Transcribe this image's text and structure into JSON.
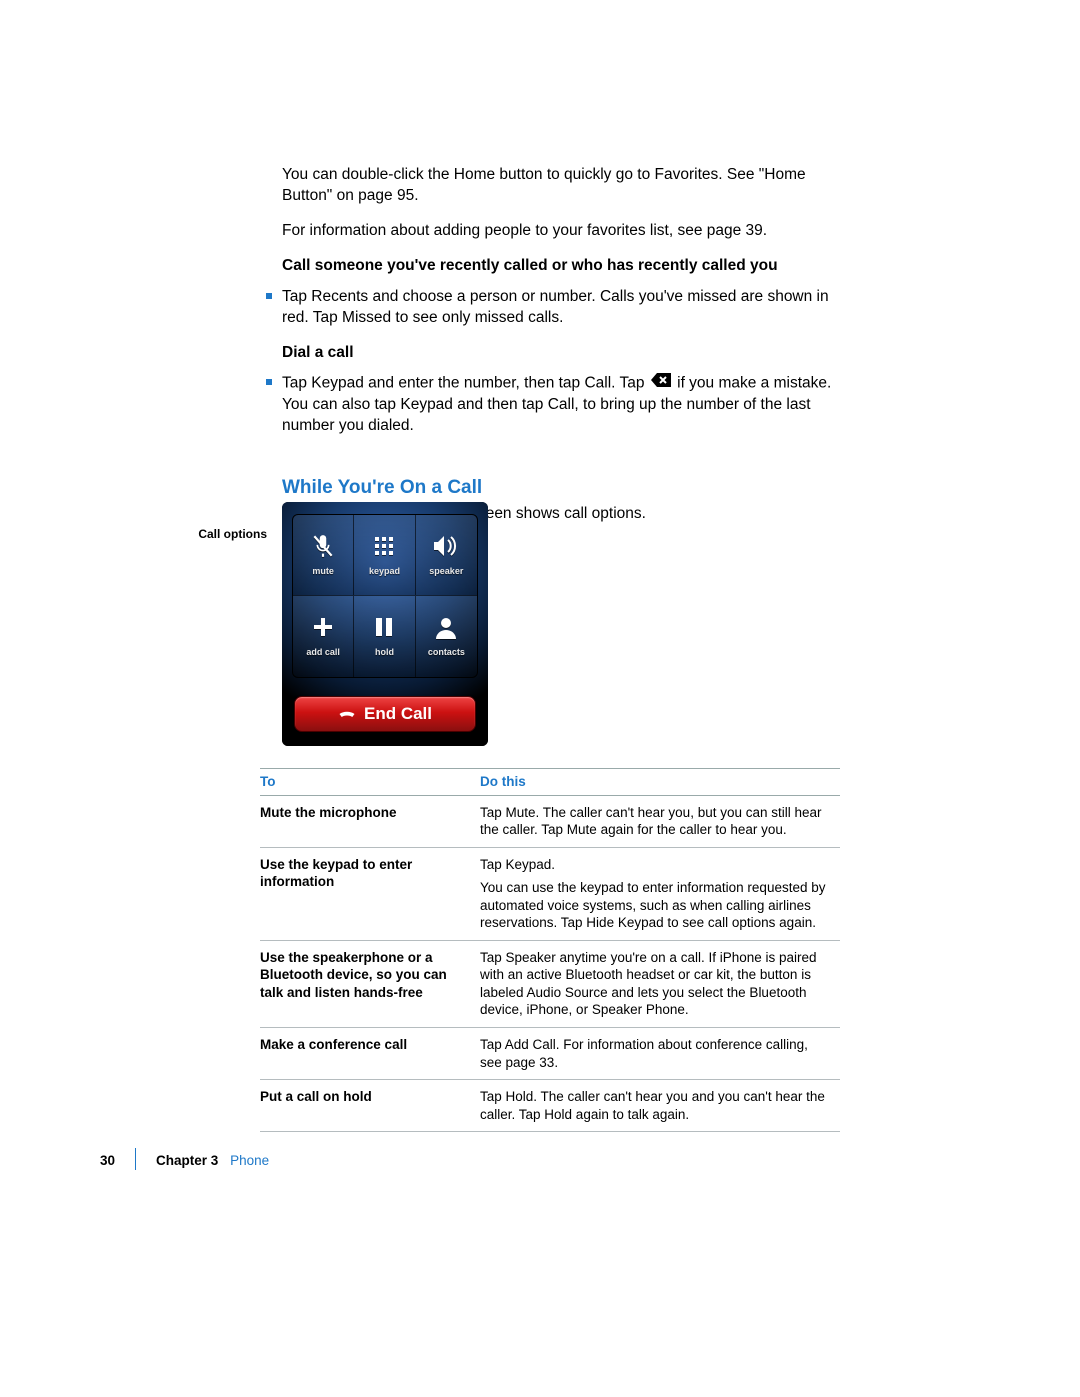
{
  "body": {
    "p1": "You can double-click the Home button to quickly go to Favorites. See \"Home Button\" on page 95.",
    "p2": "For information about adding people to your favorites list, see page 39.",
    "h_recent": "Call someone you've recently called or who has recently called you",
    "b_recent": "Tap Recents and choose a person or number. Calls you've missed are shown in red. Tap Missed to see only missed calls.",
    "h_dial": "Dial a call",
    "b_dial_pre": "Tap Keypad and enter the number, then tap Call. Tap ",
    "b_dial_post": " if you make a mistake. You can also tap Keypad and then tap Call, to bring up the number of the last number you dialed.",
    "section": "While You're On a Call",
    "section_sub": "When you're on a call, the screen shows call options."
  },
  "caption": "Call options",
  "call_options": {
    "mute": "mute",
    "keypad": "keypad",
    "speaker": "speaker",
    "add": "add call",
    "hold": "hold",
    "contacts": "contacts",
    "end": "End Call"
  },
  "table": {
    "h1": "To",
    "h2": "Do this",
    "rows": [
      {
        "to": "Mute the microphone",
        "do": [
          "Tap Mute. The caller can't hear you, but you can still hear the caller. Tap Mute again for the caller to hear you."
        ]
      },
      {
        "to": "Use the keypad to enter information",
        "do": [
          "Tap Keypad.",
          "You can use the keypad to enter information requested by automated voice systems, such as when calling airlines reservations. Tap Hide Keypad to see call options again."
        ]
      },
      {
        "to": "Use the speakerphone or a Bluetooth device, so you can talk and listen hands-free",
        "do": [
          "Tap Speaker anytime you're on a call. If iPhone is paired with an active Bluetooth headset or car kit, the button is labeled Audio Source and lets you select the Bluetooth device, iPhone, or Speaker Phone."
        ]
      },
      {
        "to": "Make a conference call",
        "do": [
          "Tap Add Call. For information about conference calling, see page 33."
        ]
      },
      {
        "to": "Put a call on hold",
        "do": [
          "Tap Hold. The caller can't hear you and you can't hear the caller. Tap Hold again to talk again."
        ]
      }
    ]
  },
  "footer": {
    "page": "30",
    "chapter": "Chapter 3",
    "name": "Phone"
  }
}
